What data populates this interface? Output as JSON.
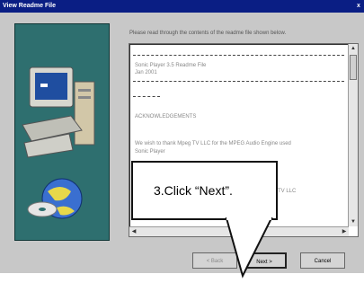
{
  "window": {
    "title": "View Readme File",
    "close_glyph": "x"
  },
  "instructions": "Please read through the contents of the readme file shown below.",
  "readme": {
    "lines": [
      "Sonic Player 3.5 Readme File",
      "Jan 2001",
      "ACKNOWLEDGEMENTS",
      "We wish to thank Mpeg TV LLC for the MPEG Audio Engine used",
      "Sonic Player",
      "MpegTV LLC"
    ]
  },
  "buttons": {
    "back": "< Back",
    "next": "Next >",
    "cancel": "Cancel"
  },
  "callout": {
    "text": "3.Click “Next”."
  },
  "colors": {
    "titlebar": "#0a1e84",
    "art_bg": "#2e6f6f",
    "dialog_bg": "#c8c8c8"
  }
}
